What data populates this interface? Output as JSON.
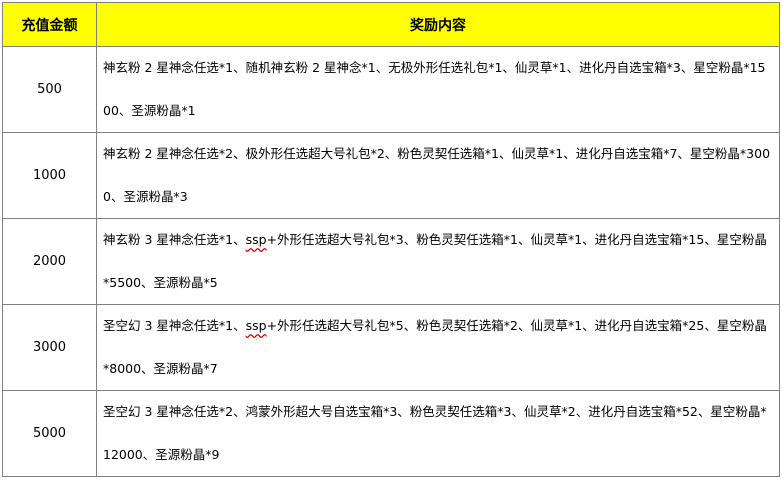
{
  "table": {
    "headers": {
      "amount": "充值金额",
      "content": "奖励内容"
    },
    "rows": [
      {
        "amount": "500",
        "pre": "神玄粉 2 星神念任选*1、随机神玄粉 2 星神念*1、无极外形任选礼包*1、仙灵草*1、进化丹自选宝箱*3、星空粉晶*1500、圣源粉晶*1",
        "ssp": "",
        "post": ""
      },
      {
        "amount": "1000",
        "pre": "神玄粉 2 星神念任选*2、极外形任选超大号礼包*2、粉色灵契任选箱*1、仙灵草*1、进化丹自选宝箱*7、星空粉晶*3000、圣源粉晶*3",
        "ssp": "",
        "post": ""
      },
      {
        "amount": "2000",
        "pre": "神玄粉 3 星神念任选*1、",
        "ssp": "ssp",
        "post": "+外形任选超大号礼包*3、粉色灵契任选箱*1、仙灵草*1、进化丹自选宝箱*15、星空粉晶*5500、圣源粉晶*5"
      },
      {
        "amount": "3000",
        "pre": "圣空幻 3 星神念任选*1、",
        "ssp": "ssp",
        "post": "+外形任选超大号礼包*5、粉色灵契任选箱*2、仙灵草*1、进化丹自选宝箱*25、星空粉晶*8000、圣源粉晶*7"
      },
      {
        "amount": "5000",
        "pre": "圣空幻 3 星神念任选*2、鸿蒙外形超大号自选宝箱*3、粉色灵契任选箱*3、仙灵草*2、进化丹自选宝箱*52、星空粉晶*12000、圣源粉晶*9",
        "ssp": "",
        "post": ""
      }
    ]
  }
}
